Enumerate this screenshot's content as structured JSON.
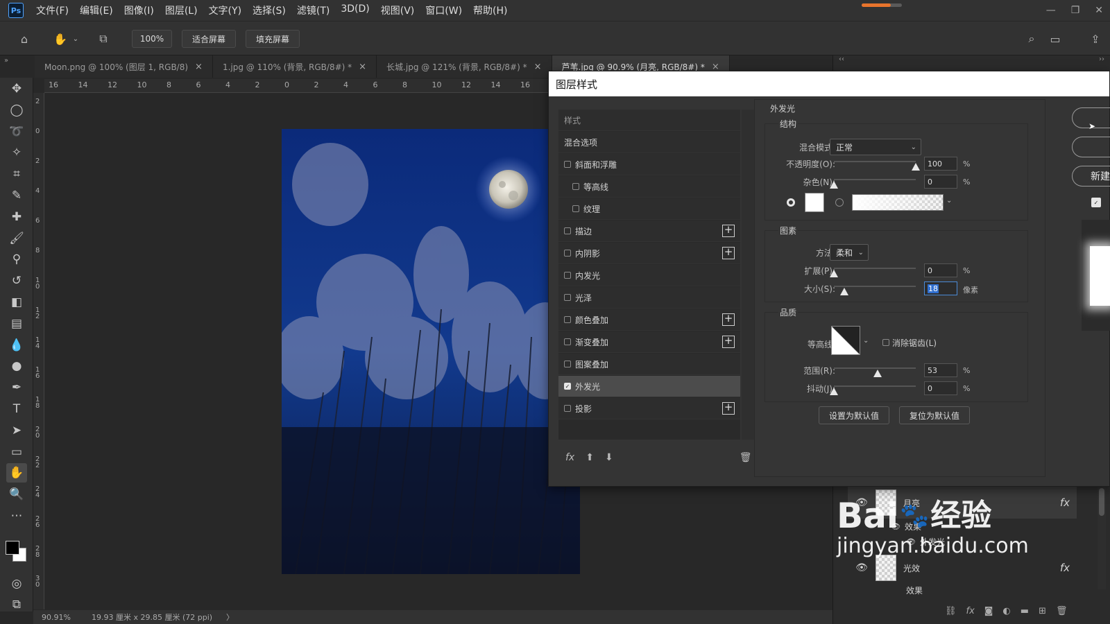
{
  "app": {
    "logo": "Ps"
  },
  "menu": [
    "文件(F)",
    "编辑(E)",
    "图像(I)",
    "图层(L)",
    "文字(Y)",
    "选择(S)",
    "滤镜(T)",
    "3D(D)",
    "视图(V)",
    "窗口(W)",
    "帮助(H)"
  ],
  "activity_progress": 0.72,
  "options": {
    "zoom_value": "100%",
    "fit_screen": "适合屏幕",
    "fill_screen": "填充屏幕"
  },
  "tabs": [
    {
      "label": "Moon.png @ 100% (图层 1, RGB/8)",
      "close": "×"
    },
    {
      "label": "1.jpg @ 110% (背景, RGB/8#) *",
      "close": "×"
    },
    {
      "label": "长城.jpg @ 121% (背景, RGB/8#) *",
      "close": "×"
    },
    {
      "label": "芦苇.jpg @ 90.9% (月亮, RGB/8#) *",
      "close": "×"
    }
  ],
  "ruler_h": [
    "16",
    "14",
    "12",
    "10",
    "8",
    "6",
    "4",
    "2",
    "0",
    "2",
    "4",
    "6",
    "8",
    "10",
    "12",
    "14",
    "16"
  ],
  "ruler_v": [
    "2",
    "0",
    "2",
    "4",
    "6",
    "8",
    "1 0",
    "1 2",
    "1 4",
    "1 6",
    "1 8",
    "2 0",
    "2 2",
    "2 4",
    "2 6",
    "2 8",
    "3 0"
  ],
  "status": {
    "zoom": "90.91%",
    "doc_size": "19.93 厘米 x 29.85 厘米 (72 ppi)",
    "arrow": "〉"
  },
  "dialog": {
    "title": "图层样式",
    "styles_header": "样式",
    "blend_options": "混合选项",
    "styles": [
      {
        "label": "斜面和浮雕",
        "checked": false,
        "plus": false,
        "indent": false
      },
      {
        "label": "等高线",
        "checked": false,
        "plus": false,
        "indent": true
      },
      {
        "label": "纹理",
        "checked": false,
        "plus": false,
        "indent": true
      },
      {
        "label": "描边",
        "checked": false,
        "plus": true,
        "indent": false
      },
      {
        "label": "内阴影",
        "checked": false,
        "plus": true,
        "indent": false
      },
      {
        "label": "内发光",
        "checked": false,
        "plus": false,
        "indent": false
      },
      {
        "label": "光泽",
        "checked": false,
        "plus": false,
        "indent": false
      },
      {
        "label": "颜色叠加",
        "checked": false,
        "plus": true,
        "indent": false
      },
      {
        "label": "渐变叠加",
        "checked": false,
        "plus": true,
        "indent": false
      },
      {
        "label": "图案叠加",
        "checked": false,
        "plus": false,
        "indent": false
      },
      {
        "label": "外发光",
        "checked": true,
        "plus": false,
        "indent": false
      },
      {
        "label": "投影",
        "checked": false,
        "plus": true,
        "indent": false
      }
    ],
    "fx_label": "fx",
    "outer_glow": {
      "title": "外发光",
      "structure": {
        "title": "结构",
        "blend_mode_label": "混合模式:",
        "blend_mode_value": "正常",
        "opacity_label": "不透明度(O):",
        "opacity_value": "100",
        "noise_label": "杂色(N):",
        "noise_value": "0",
        "percent": "%"
      },
      "elements": {
        "title": "图素",
        "method_label": "方法:",
        "method_value": "柔和",
        "spread_label": "扩展(P):",
        "spread_value": "0",
        "size_label": "大小(S):",
        "size_value": "18",
        "size_unit": "像素",
        "percent": "%"
      },
      "quality": {
        "title": "品质",
        "contour_label": "等高线:",
        "anti_alias_label": "消除锯齿(L)",
        "range_label": "范围(R):",
        "range_value": "53",
        "jitter_label": "抖动(J):",
        "jitter_value": "0",
        "percent": "%"
      },
      "set_default": "设置为默认值",
      "reset_default": "复位为默认值"
    },
    "side_buttons": {
      "new_style": "新建"
    },
    "slider_levels": {
      "opacity": 1.0,
      "noise": 0.0,
      "spread": 0.0,
      "size": 0.13,
      "range": 0.53,
      "jitter": 0.0
    }
  },
  "layers": {
    "moon_layer": "月亮",
    "effects": "效果",
    "outer_glow": "外发光",
    "glow_layer": "光效",
    "effects2": "效果",
    "fx": "fx"
  },
  "watermark": {
    "line1": "Bai",
    "line1b": "经验",
    "line2": "jingyan.baidu.com"
  }
}
